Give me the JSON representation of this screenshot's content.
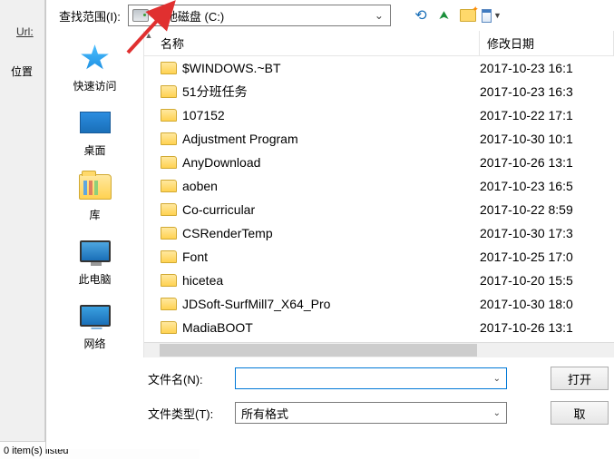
{
  "shell": {
    "url_label": "Url:",
    "pos_label": "位置",
    "status": "0 item(s) listed"
  },
  "dialog": {
    "lookin_label": "查找范围(I):",
    "lookin_value": "本地磁盘 (C:)",
    "nav": {
      "back": "后退",
      "up": "向上一级",
      "newfolder": "新建文件夹",
      "views": "视图"
    }
  },
  "sidebar": {
    "items": [
      {
        "label": "快速访问"
      },
      {
        "label": "桌面"
      },
      {
        "label": "库"
      },
      {
        "label": "此电脑"
      },
      {
        "label": "网络"
      }
    ]
  },
  "columns": {
    "name": "名称",
    "date": "修改日期"
  },
  "files": [
    {
      "name": "$WINDOWS.~BT",
      "date": "2017-10-23 16:1"
    },
    {
      "name": "51分班任务",
      "date": "2017-10-23 16:3"
    },
    {
      "name": "107152",
      "date": "2017-10-22 17:1"
    },
    {
      "name": "Adjustment Program",
      "date": "2017-10-30 10:1"
    },
    {
      "name": "AnyDownload",
      "date": "2017-10-26 13:1"
    },
    {
      "name": "aoben",
      "date": "2017-10-23 16:5"
    },
    {
      "name": "Co-curricular",
      "date": "2017-10-22 8:59"
    },
    {
      "name": "CSRenderTemp",
      "date": "2017-10-30 17:3"
    },
    {
      "name": "Font",
      "date": "2017-10-25 17:0"
    },
    {
      "name": "hicetea",
      "date": "2017-10-20 15:5"
    },
    {
      "name": "JDSoft-SurfMill7_X64_Pro",
      "date": "2017-10-30 18:0"
    },
    {
      "name": "MadiaBOOT",
      "date": "2017-10-26 13:1"
    }
  ],
  "bottom": {
    "filename_label": "文件名(N):",
    "filename_value": "",
    "filetype_label": "文件类型(T):",
    "filetype_value": "所有格式",
    "open": "打开",
    "cancel": "取"
  }
}
